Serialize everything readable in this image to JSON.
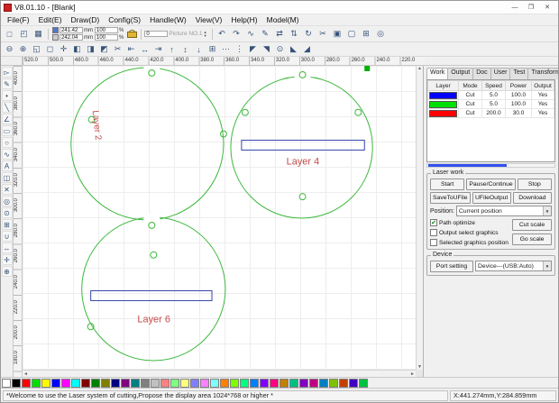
{
  "window": {
    "title": "V8.01.10 - [Blank]",
    "controls": {
      "minimize": "—",
      "maximize": "❐",
      "close": "✕"
    }
  },
  "menu": {
    "items": [
      "File(F)",
      "Edit(E)",
      "Draw(D)",
      "Config(S)",
      "Handle(W)",
      "View(V)",
      "Help(H)",
      "Model(M)"
    ]
  },
  "toolbar1": {
    "file_icons": [
      {
        "name": "new-file-icon",
        "glyph": "□"
      },
      {
        "name": "open-file-icon",
        "glyph": "◰"
      },
      {
        "name": "save-file-icon",
        "glyph": "▦"
      }
    ],
    "fields": {
      "width": "241.42",
      "width_unit": "mm",
      "height": "242.04",
      "height_unit": "mm",
      "scale_x": "100",
      "scale_x_unit": "%",
      "scale_y": "100",
      "scale_y_unit": "%",
      "angle": "0"
    },
    "picture_no": "Picture NO.1",
    "icons": [
      {
        "name": "undo-icon",
        "glyph": "↶"
      },
      {
        "name": "redo-icon",
        "glyph": "↷"
      },
      {
        "name": "draw-curve-icon",
        "glyph": "∿"
      },
      {
        "name": "node-edit-icon",
        "glyph": "✎"
      },
      {
        "name": "mirror-horizontal-icon",
        "glyph": "⇄"
      },
      {
        "name": "mirror-vertical-icon",
        "glyph": "⇅"
      },
      {
        "name": "rotate-icon",
        "glyph": "↻"
      },
      {
        "name": "scissors-icon",
        "glyph": "✂"
      },
      {
        "name": "group-icon",
        "glyph": "▣"
      },
      {
        "name": "ungroup-icon",
        "glyph": "▢"
      },
      {
        "name": "array-copy-icon",
        "glyph": "⊞"
      },
      {
        "name": "offset-icon",
        "glyph": "◎"
      }
    ]
  },
  "toolbar2": {
    "icons": [
      {
        "name": "zoom-out-icon",
        "glyph": "⊖"
      },
      {
        "name": "zoom-in-icon",
        "glyph": "⊕"
      },
      {
        "name": "zoom-window-icon",
        "glyph": "◱"
      },
      {
        "name": "zoom-all-icon",
        "glyph": "◻"
      },
      {
        "name": "pan-icon",
        "glyph": "✛"
      },
      {
        "name": "shape-union-icon",
        "glyph": "◧"
      },
      {
        "name": "shape-subtract-icon",
        "glyph": "◨"
      },
      {
        "name": "shape-intersect-icon",
        "glyph": "◩"
      },
      {
        "name": "cut-shape-icon",
        "glyph": "✂"
      },
      {
        "name": "align-left-icon",
        "glyph": "⇤"
      },
      {
        "name": "align-center-h-icon",
        "glyph": "↔"
      },
      {
        "name": "align-right-icon",
        "glyph": "⇥"
      },
      {
        "name": "align-top-icon",
        "glyph": "↑"
      },
      {
        "name": "align-center-v-icon",
        "glyph": "↕"
      },
      {
        "name": "align-bottom-icon",
        "glyph": "↓"
      },
      {
        "name": "same-size-icon",
        "glyph": "⊞"
      },
      {
        "name": "distribute-h-icon",
        "glyph": "⋯"
      },
      {
        "name": "distribute-v-icon",
        "glyph": "⋮"
      },
      {
        "name": "laser-pos-top-left-icon",
        "glyph": "◤"
      },
      {
        "name": "laser-pos-top-right-icon",
        "glyph": "◥"
      },
      {
        "name": "laser-pos-center-icon",
        "glyph": "⊙"
      },
      {
        "name": "laser-pos-bottom-left-icon",
        "glyph": "◣"
      },
      {
        "name": "laser-pos-bottom-right-icon",
        "glyph": "◢"
      }
    ]
  },
  "left_toolbar": {
    "icons": [
      {
        "name": "select-tool-icon",
        "glyph": "▻"
      },
      {
        "name": "node-edit-tool-icon",
        "glyph": "✎"
      },
      {
        "name": "point-tool-icon",
        "glyph": "•"
      },
      {
        "name": "line-tool-icon",
        "glyph": "╲"
      },
      {
        "name": "polyline-tool-icon",
        "glyph": "∠"
      },
      {
        "name": "rectangle-tool-icon",
        "glyph": "▭"
      },
      {
        "name": "ellipse-tool-icon",
        "glyph": "○"
      },
      {
        "name": "curve-tool-icon",
        "glyph": "∿"
      },
      {
        "name": "text-tool-icon",
        "glyph": "A"
      },
      {
        "name": "image-tool-icon",
        "glyph": "◫"
      },
      {
        "name": "delete-tool-icon",
        "glyph": "✕"
      },
      {
        "name": "offset-tool-icon",
        "glyph": "◎"
      },
      {
        "name": "drill-tool-icon",
        "glyph": "⊙"
      },
      {
        "name": "array-tool-icon",
        "glyph": "⊞"
      },
      {
        "name": "weld-tool-icon",
        "glyph": "∪"
      },
      {
        "name": "measure-tool-icon",
        "glyph": "↔"
      },
      {
        "name": "hand-pan-tool-icon",
        "glyph": "✛"
      },
      {
        "name": "zoom-tool-icon",
        "glyph": "⊕"
      }
    ]
  },
  "rulers": {
    "top": [
      "520.0",
      "500.0",
      "480.0",
      "460.0",
      "440.0",
      "420.0",
      "400.0",
      "380.0",
      "360.0",
      "340.0",
      "320.0",
      "300.0",
      "280.0",
      "260.0",
      "240.0",
      "220.0"
    ],
    "left": [
      "400.0",
      "380.0",
      "360.0",
      "340.0",
      "320.0",
      "300.0",
      "280.0",
      "260.0",
      "240.0",
      "220.0",
      "200.0",
      "180.0"
    ]
  },
  "canvas": {
    "labels": {
      "layer2": "Layer 2",
      "layer4": "Layer 4",
      "layer6": "Layer 6"
    },
    "colors": {
      "outline_green": "#3cb83c",
      "rect_blue": "#3344aa",
      "label_red": "#c44c4c",
      "marker_green": "#00b000"
    }
  },
  "right_panel": {
    "tabs": [
      "Work",
      "Output",
      "Doc",
      "User",
      "Test",
      "Transform"
    ],
    "layer_table": {
      "headers": [
        "Layer",
        "Mode",
        "Speed",
        "Power",
        "Output"
      ],
      "rows": [
        {
          "color": "#0000ff",
          "mode": "Cut",
          "speed": "5.0",
          "power": "100.0",
          "output": "Yes"
        },
        {
          "color": "#00e000",
          "mode": "Cut",
          "speed": "5.0",
          "power": "100.0",
          "output": "Yes"
        },
        {
          "color": "#ff0000",
          "mode": "Cut",
          "speed": "200.0",
          "power": "30.0",
          "output": "Yes"
        }
      ]
    },
    "laser_work": {
      "title": "Laser work",
      "start": "Start",
      "pause": "Pause/Continue",
      "stop": "Stop",
      "save_ufile": "SaveToUFile",
      "ufile_output": "UFileOutput",
      "download": "Download",
      "position_label": "Position:",
      "position_value": "Current position",
      "checkboxes": [
        {
          "label": "Path optimize",
          "mark": "✔"
        },
        {
          "label": "Output select graphics",
          "mark": ""
        },
        {
          "label": "Selected graphics position",
          "mark": ""
        }
      ],
      "cut_scale": "Cut scale",
      "go_scale": "Go scale"
    },
    "device": {
      "title": "Device",
      "port_setting": "Port setting",
      "device_value": "Device---(USB:Auto)"
    }
  },
  "palette": {
    "colors": [
      "#ffffff",
      "#000000",
      "#ff0000",
      "#00e000",
      "#ffff00",
      "#0000ff",
      "#ff00ff",
      "#00ffff",
      "#800000",
      "#008000",
      "#808000",
      "#000080",
      "#800080",
      "#008080",
      "#808080",
      "#c0c0c0",
      "#ff8080",
      "#80ff80",
      "#ffff80",
      "#8080ff",
      "#ff80ff",
      "#80ffff",
      "#ff8000",
      "#80ff00",
      "#00ff80",
      "#0080ff",
      "#8000ff",
      "#ff0080",
      "#c08000",
      "#00c080",
      "#8000c0",
      "#c00080",
      "#0080c0",
      "#80c000",
      "#c04000",
      "#4000c0",
      "#00c040"
    ]
  },
  "status_bar": {
    "message": "*Welcome to use the Laser system of cutting,Propose the display area 1024*768 or higher *",
    "coords": "X:441.274mm,Y:284.859mm"
  }
}
